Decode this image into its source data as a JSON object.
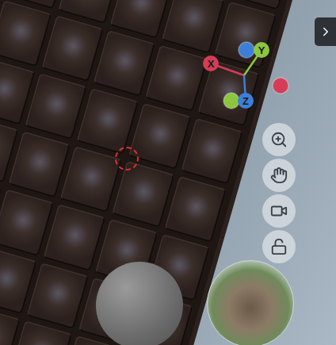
{
  "gizmo": {
    "axes": [
      {
        "label": "X",
        "color": "#d43d55"
      },
      {
        "label": "Y",
        "color": "#8cc63f"
      },
      {
        "label": "Z",
        "color": "#3d7fd6"
      }
    ]
  },
  "lock": {
    "locked": false
  }
}
